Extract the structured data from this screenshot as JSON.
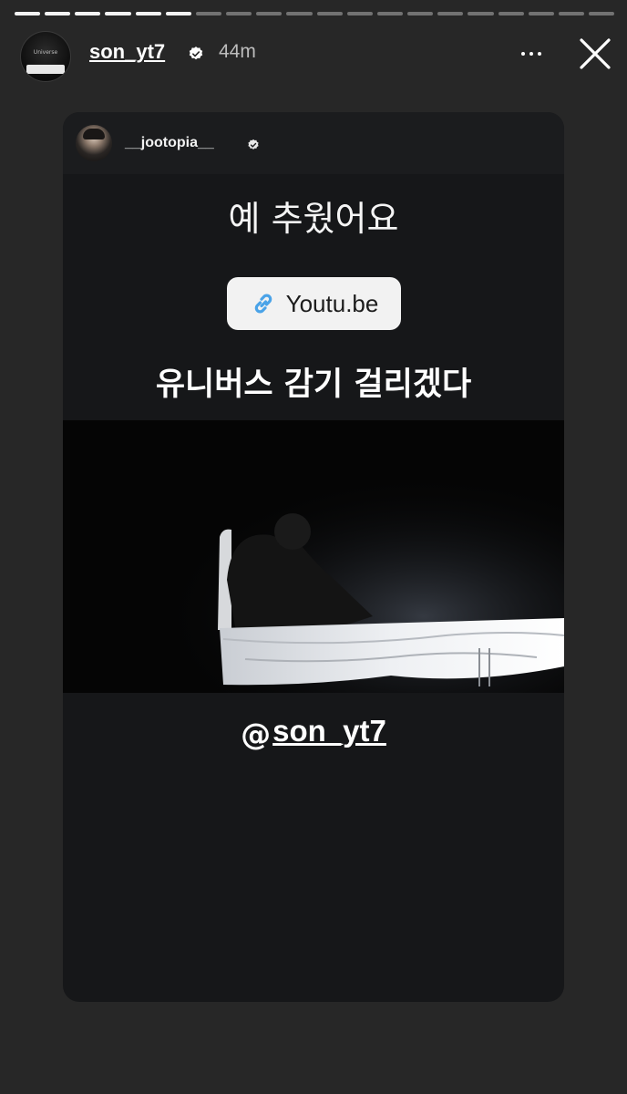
{
  "story": {
    "progress_total": 20,
    "progress_seen": 6
  },
  "header": {
    "username": "son_yt7",
    "time_ago": "44m",
    "avatar_text": "Universe",
    "avatar_icon": "profile-avatar",
    "verified_icon": "verified-badge-icon",
    "more_icon": "more-options-icon",
    "close_icon": "close-icon"
  },
  "shared_post": {
    "author": "__jootopia__",
    "line1": "예 추웠어요",
    "link_sticker": {
      "label": "Youtu.be",
      "icon": "link-icon"
    },
    "line2": "유니버스 감기 걸리겠다",
    "mention": "son_yt7",
    "mention_icon_glyph": "@"
  },
  "colors": {
    "background": "#272727",
    "card": "#161719",
    "link_icon": "#4aa3e8",
    "text": "#ffffff"
  }
}
